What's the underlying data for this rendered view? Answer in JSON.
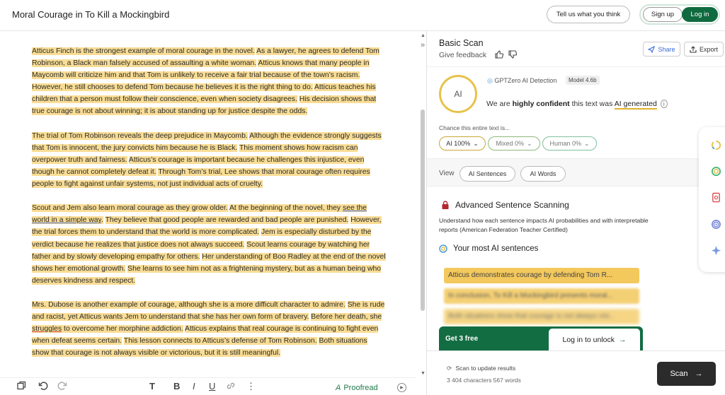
{
  "header": {
    "doc_title": "Moral Courage in To Kill a Mockingbird",
    "feedback_label": "Tell us what you think",
    "signup_label": "Sign up",
    "login_label": "Log in"
  },
  "editor": {
    "p1": [
      {
        "t": "Atticus Finch is the strongest example of moral courage in the novel.",
        "hl": true
      },
      {
        "t": " ",
        "hl": false
      },
      {
        "t": "As a lawyer, he agrees to defend Tom Robinson, a Black man falsely accused of assaulting a white woman.",
        "hl": true
      },
      {
        "t": " ",
        "hl": false
      },
      {
        "t": "Atticus knows that many people in Maycomb will criticize him and that Tom is unlikely to receive a fair trial because of the town’s racism.",
        "hl": true
      },
      {
        "t": " ",
        "hl": false
      },
      {
        "t": "However, he still chooses to defend Tom because he believes it is the right thing to do.",
        "hl": true
      },
      {
        "t": " ",
        "hl": false
      },
      {
        "t": "Atticus teaches his children that a person must follow their conscience, even when society disagrees.",
        "hl": true
      },
      {
        "t": " ",
        "hl": false
      },
      {
        "t": "His decision shows that true courage is not about winning; it is about standing up for justice despite the odds.",
        "hl": true
      }
    ],
    "p2": [
      {
        "t": "The trial of Tom Robinson reveals the deep prejudice in Maycomb.",
        "hl": true
      },
      {
        "t": " ",
        "hl": false
      },
      {
        "t": "Although the evidence strongly suggests that Tom is innocent, the jury convicts him because he is Black.",
        "hl": true
      },
      {
        "t": " ",
        "hl": false
      },
      {
        "t": "This moment shows how racism can overpower truth and fairness.",
        "hl": true
      },
      {
        "t": " ",
        "hl": false
      },
      {
        "t": "Atticus’s courage is important because he challenges this injustice, even though he cannot completely defeat it.",
        "hl": true
      },
      {
        "t": " ",
        "hl": false
      },
      {
        "t": "Through Tom’s trial, Lee shows that moral courage often requires people to fight against unfair systems, not just individual acts of cruelty.",
        "hl": true
      }
    ],
    "p3": [
      {
        "t": "Scout and Jem also learn moral courage as they grow older.",
        "hl": true
      },
      {
        "t": " ",
        "hl": false
      },
      {
        "t": "At the beginning of the novel, they ",
        "hl": true
      },
      {
        "t": "see the world in a simple way",
        "hl": true,
        "ul": "blue"
      },
      {
        "t": ".",
        "hl": true
      },
      {
        "t": " ",
        "hl": false
      },
      {
        "t": "They believe that good people are rewarded and bad people are punished.",
        "hl": true
      },
      {
        "t": " ",
        "hl": false
      },
      {
        "t": "However, the trial forces them to understand that the world is more complicated.",
        "hl": true
      },
      {
        "t": " ",
        "hl": false
      },
      {
        "t": "Jem is especially disturbed by the verdict because he realizes that justice does not always succeed.",
        "hl": true
      },
      {
        "t": " ",
        "hl": false
      },
      {
        "t": "Scout learns courage by watching her father and by slowly developing empathy for others.",
        "hl": true
      },
      {
        "t": " ",
        "hl": false
      },
      {
        "t": "Her understanding of Boo Radley at the end of the novel shows her emotional growth.",
        "hl": true
      },
      {
        "t": " ",
        "hl": false
      },
      {
        "t": "She learns to see him not as a frightening mystery, but as a human being who deserves kindness and respect.",
        "hl": true
      }
    ],
    "p4": [
      {
        "t": "Mrs. Dubose is another example of courage, although she is a more difficult character to admire.",
        "hl": true
      },
      {
        "t": " ",
        "hl": false
      },
      {
        "t": "She is rude and racist, yet Atticus wants Jem to understand that she has her own form of bravery.",
        "hl": true
      },
      {
        "t": " ",
        "hl": false
      },
      {
        "t": "Before her death, she ",
        "hl": true
      },
      {
        "t": "struggles",
        "hl": true,
        "ul": "red"
      },
      {
        "t": " to overcome her morphine addiction.",
        "hl": true
      },
      {
        "t": " ",
        "hl": false
      },
      {
        "t": "Atticus explains that real courage is continuing to fight even when defeat seems certain.",
        "hl": true
      },
      {
        "t": " ",
        "hl": false
      },
      {
        "t": "This lesson connects to Atticus’s defense of Tom Robinson.",
        "hl": true
      },
      {
        "t": " ",
        "hl": false
      },
      {
        "t": "Both situations show that courage is not always visible or victorious, but it is still meaningful.",
        "hl": true
      }
    ]
  },
  "toolbar": {
    "proofread_label": "Proofread"
  },
  "panel": {
    "scan_title": "Basic Scan",
    "give_feedback": "Give feedback",
    "share_label": "Share",
    "export_label": "Export",
    "ai_circle_label": "AI",
    "detection_label": "GPTZero AI Detection",
    "model_badge": "Model 4.6b",
    "confidence_pre": "We are ",
    "confidence_bold": "highly confident",
    "confidence_mid": " this text was ",
    "confidence_ai": "AI generated",
    "chance_label": "Chance this entire text is...",
    "pill_ai": "AI 100%",
    "pill_mixed": "Mixed 0%",
    "pill_human": "Human 0%",
    "view_label": "View",
    "view_sentences": "AI Sentences",
    "view_words": "AI Words",
    "adv_title": "Advanced Sentence Scanning",
    "adv_desc": "Understand how each sentence impacts AI probabilities and with interpretable reports (American Federation Teacher Certified)",
    "most_title": "Your most AI sentences",
    "sentences": [
      "Atticus demonstrates courage by defending Tom R...",
      "In conclusion, To Kill a Mockingbird presents moral...",
      "Both situations show that courage is not always visi..."
    ],
    "get_free": "Get 3 free",
    "unlock_label": "Log in to unlock",
    "scan_update": "Scan to update results",
    "char_count": "3 404 characters 567 words",
    "scan_label": "Scan"
  },
  "colors": {
    "highlight": "#f9dd95",
    "brand_green": "#0f6a3f",
    "ai_yellow": "#e8c24a"
  }
}
